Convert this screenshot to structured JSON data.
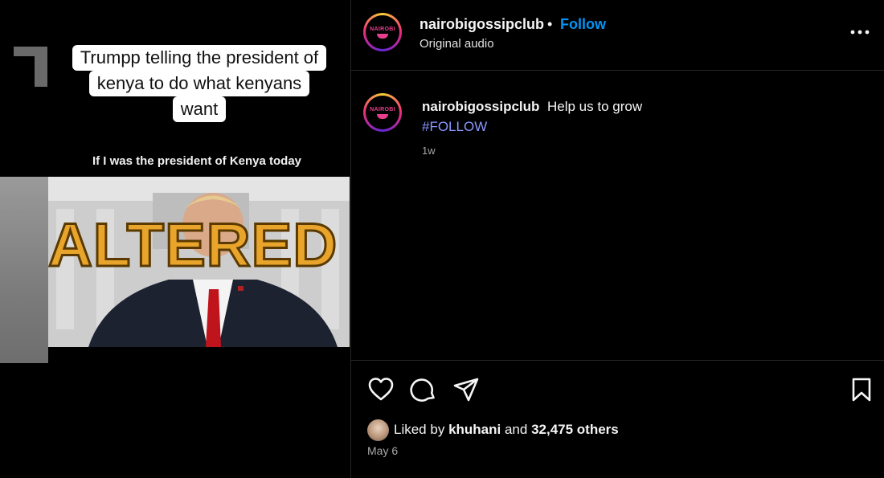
{
  "media": {
    "caption_lines": [
      "Trumpp telling the president of",
      "kenya to do what kenyans",
      "want"
    ],
    "sub_caption": "If I was the president of Kenya today",
    "overlay_label": "ALTERED"
  },
  "post": {
    "header": {
      "username": "nairobigossipclub",
      "separator": "•",
      "follow_label": "Follow",
      "audio_label": "Original audio",
      "avatar_logo_text": "NAIROBI",
      "more_icon": "more-horizontal-icon"
    },
    "comment": {
      "username": "nairobigossipclub",
      "text": "Help us to grow",
      "hashtag": "#FOLLOW",
      "time": "1w"
    },
    "actions": {
      "icons": [
        "heart-icon",
        "comment-icon",
        "share-icon",
        "bookmark-icon"
      ]
    },
    "likes": {
      "prefix": "Liked by",
      "user": "khuhani",
      "middle": "and",
      "count": "32,475 others"
    },
    "date": "May 6"
  },
  "colors": {
    "background": "#000000",
    "link_blue": "#0095f6",
    "hashtag": "#8a97ff",
    "altered_gold": "#e9a52b",
    "muted_text": "#a8a8a8"
  }
}
